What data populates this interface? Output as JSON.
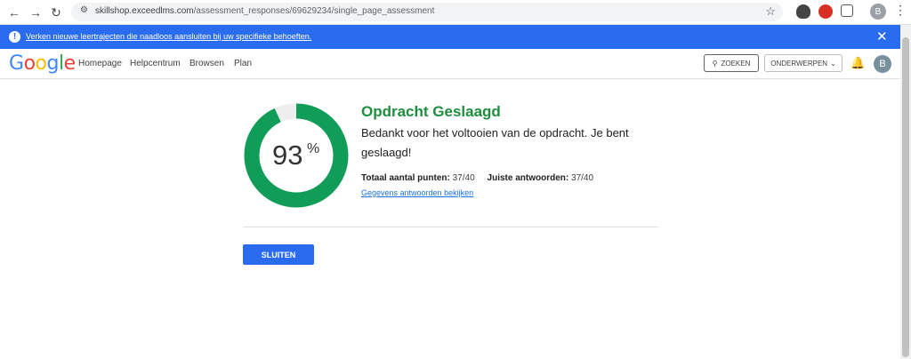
{
  "browser": {
    "url_host": "skillshop.exceedlms.com",
    "url_path": "/assessment_responses/69629234/single_page_assessment",
    "profile_initial": "B"
  },
  "banner": {
    "text": "Verken nieuwe leertrajecten die naadloos aansluiten bij uw specifieke behoeften.",
    "color": "#2a6cf0"
  },
  "header": {
    "logo": [
      "G",
      "o",
      "o",
      "g",
      "l",
      "e"
    ],
    "logo_colors": [
      "#4285f4",
      "#ea4335",
      "#fbbc05",
      "#4285f4",
      "#34a853",
      "#ea4335"
    ],
    "nav": [
      "Homepage",
      "Helpcentrum",
      "Browsen",
      "Plan"
    ],
    "search_label": "ZOEKEN",
    "topics_label": "ONDERWERPEN",
    "avatar_initial": "B"
  },
  "result": {
    "score_value": 0.93,
    "score": "93",
    "percent_sign": "%",
    "title": "Opdracht Geslaagd",
    "message": "Bedankt voor het voltooien van de opdracht. Je bent geslaagd!",
    "points_label": "Totaal aantal punten:",
    "points_value": "37/40",
    "correct_label": "Juiste antwoorden:",
    "correct_value": "37/40",
    "details_link": "Gegevens antwoorden bekijken",
    "close_label": "SLUITEN",
    "ring_color": "#0f9d58",
    "ring_bg_color": "#eeeeee"
  }
}
